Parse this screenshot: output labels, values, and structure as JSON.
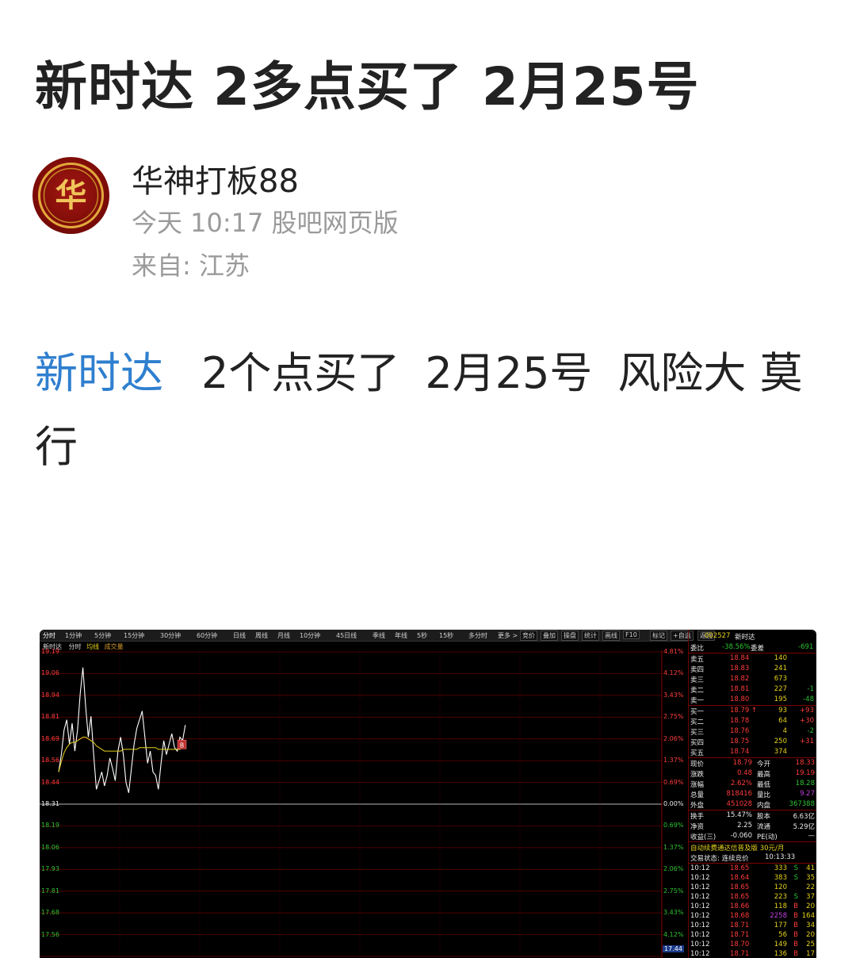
{
  "post": {
    "title": "新时达 2多点买了 2月25号",
    "author": "华神打板88",
    "avatar_text": "华",
    "time": "今天 10:17 股吧网页版",
    "source": "来自: 江苏",
    "body_link": "新时达",
    "body_segments": [
      "2个点买了",
      "2月25号",
      "风险大 莫行"
    ]
  },
  "terminal": {
    "toolbar": [
      "分时",
      "1分钟",
      "5分钟",
      "15分钟",
      "30分钟",
      "60分钟",
      "日线",
      "周线",
      "月线",
      "10分钟",
      "45日线",
      "季线",
      "年线",
      "5秒",
      "15秒",
      "多分时",
      "更多 >"
    ],
    "toolbar_right": [
      "竞价",
      "叠加",
      "操盘",
      "统计",
      "画线",
      "F10",
      "标记",
      "+自选",
      "返回"
    ],
    "chart_header": {
      "name": "新时达",
      "tab": "分时",
      "avg": "均线",
      "vol": "成交量"
    },
    "price_labels": [
      "19.19",
      "19.06",
      "18.94",
      "18.81",
      "18.69",
      "18.56",
      "18.44",
      "18.31",
      "18.19",
      "18.06",
      "17.93",
      "17.81",
      "17.68",
      "17.56"
    ],
    "pct_labels": [
      "4.81%",
      "4.12%",
      "3.43%",
      "2.75%",
      "2.06%",
      "1.37%",
      "0.69%",
      "0.00%",
      "0.69%",
      "1.37%",
      "2.06%",
      "2.75%",
      "3.43%",
      "4.12%"
    ],
    "bottom_marker": "17.44",
    "buy_marker": "B",
    "colors": {
      "up": "#ff3c3c",
      "down": "#2fc233",
      "grid": "#6a0000",
      "price_line": "#ffffff",
      "avg_line": "#e6d21a"
    },
    "chart_data": {
      "type": "line",
      "prev_close": 18.31,
      "ylim": [
        17.44,
        19.19
      ],
      "x_points": 240,
      "series": [
        {
          "values": [
            18.5,
            18.6,
            18.74,
            18.8,
            18.66,
            18.78,
            18.62,
            18.74,
            18.95,
            19.1,
            18.88,
            18.7,
            18.82,
            18.6,
            18.4,
            18.45,
            18.5,
            18.42,
            18.48,
            18.58,
            18.52,
            18.45,
            18.62,
            18.7,
            18.6,
            18.44,
            18.38,
            18.52,
            18.66,
            18.75,
            18.8,
            18.85,
            18.7,
            18.55,
            18.62,
            18.5,
            18.48,
            18.4,
            18.55,
            18.68,
            18.6,
            18.66,
            18.72,
            18.64,
            18.62,
            18.7,
            18.68,
            18.77
          ]
        },
        {
          "values": [
            18.5,
            18.56,
            18.61,
            18.64,
            18.66,
            18.67,
            18.67,
            18.68,
            18.69,
            18.7,
            18.7,
            18.69,
            18.68,
            18.67,
            18.65,
            18.64,
            18.63,
            18.62,
            18.62,
            18.62,
            18.62,
            18.62,
            18.62,
            18.62,
            18.63,
            18.63,
            18.63,
            18.63,
            18.63,
            18.63,
            18.64,
            18.64,
            18.64,
            18.64,
            18.64,
            18.64,
            18.64,
            18.63,
            18.63,
            18.63,
            18.63,
            18.63,
            18.63,
            18.63,
            18.63,
            18.63,
            18.64,
            18.64
          ]
        }
      ]
    },
    "panel": {
      "code": "002527",
      "name": "新时达",
      "wb_label": "委比",
      "wb_value": "-38.56%",
      "wc_label": "委差",
      "wc_value": "-691",
      "asks": [
        {
          "label": "卖五",
          "price": "18.84",
          "vol": "140",
          "chg": ""
        },
        {
          "label": "卖四",
          "price": "18.83",
          "vol": "241",
          "chg": ""
        },
        {
          "label": "卖三",
          "price": "18.82",
          "vol": "673",
          "chg": ""
        },
        {
          "label": "卖二",
          "price": "18.81",
          "vol": "227",
          "chg": "-1"
        },
        {
          "label": "卖一",
          "price": "18.80",
          "vol": "195",
          "chg": "-48"
        }
      ],
      "bids": [
        {
          "label": "买一",
          "price": "18.79 ↑",
          "vol": "93",
          "chg": "+93"
        },
        {
          "label": "买二",
          "price": "18.78",
          "vol": "64",
          "chg": "+30"
        },
        {
          "label": "买三",
          "price": "18.76",
          "vol": "4",
          "chg": "-2"
        },
        {
          "label": "买四",
          "price": "18.75",
          "vol": "250",
          "chg": "+31"
        },
        {
          "label": "买五",
          "price": "18.74",
          "vol": "374",
          "chg": ""
        }
      ],
      "stats": [
        {
          "l1": "现价",
          "v1": "18.79",
          "l2": "今开",
          "v2": "18.33"
        },
        {
          "l1": "涨跌",
          "v1": "0.48",
          "l2": "最高",
          "v2": "19.19"
        },
        {
          "l1": "涨幅",
          "v1": "2.62%",
          "l2": "最低",
          "v2": "18.28"
        },
        {
          "l1": "总量",
          "v1": "818416",
          "l2": "量比",
          "v2": "9.27"
        },
        {
          "l1": "外盘",
          "v1": "451028",
          "l2": "内盘",
          "v2": "367388"
        },
        {
          "l1": "换手",
          "v1": "15.47%",
          "l2": "股本",
          "v2": "6.63亿"
        },
        {
          "l1": "净资",
          "v1": "2.25",
          "l2": "流通",
          "v2": "5.29亿"
        },
        {
          "l1": "收益(三)",
          "v1": "-0.060",
          "l2": "PE(动)",
          "v2": "—"
        }
      ],
      "notice": "自动续费通达信普及版 30元/月",
      "status_label": "交易状态: 连续竞价",
      "status_time": "10:13:33",
      "ticks": [
        {
          "time": "10:12",
          "price": "18.65",
          "vol": "333",
          "side": "S",
          "n": "41"
        },
        {
          "time": "10:12",
          "price": "18.64",
          "vol": "383",
          "side": "S",
          "n": "35"
        },
        {
          "time": "10:12",
          "price": "18.65",
          "vol": "120",
          "side": "",
          "n": "22"
        },
        {
          "time": "10:12",
          "price": "18.65",
          "vol": "223",
          "side": "S",
          "n": "37"
        },
        {
          "time": "10:12",
          "price": "18.66",
          "vol": "118",
          "side": "B",
          "n": "20"
        },
        {
          "time": "10:12",
          "price": "18.68",
          "vol": "2258",
          "side": "B",
          "n": "164"
        },
        {
          "time": "10:12",
          "price": "18.71",
          "vol": "177",
          "side": "B",
          "n": "34"
        },
        {
          "time": "10:12",
          "price": "18.71",
          "vol": "56",
          "side": "B",
          "n": "20"
        },
        {
          "time": "10:12",
          "price": "18.70",
          "vol": "149",
          "side": "B",
          "n": "25"
        },
        {
          "time": "10:12",
          "price": "18.71",
          "vol": "136",
          "side": "B",
          "n": "17"
        }
      ]
    }
  }
}
